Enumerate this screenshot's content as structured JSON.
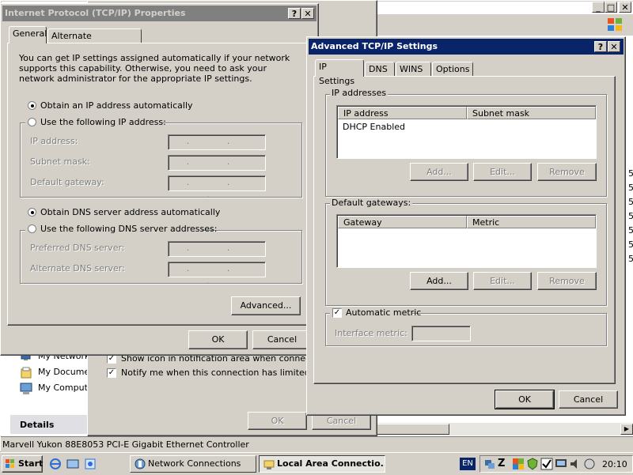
{
  "colors": {
    "desktop": "#3a6ea5",
    "title_active": "#0a246a",
    "title_inactive": "#808080",
    "face": "#d4d0c8"
  },
  "tcpip": {
    "title": "Internet Protocol (TCP/IP) Properties",
    "tabs": [
      "General",
      "Alternate Configuration"
    ],
    "intro": "You can get IP settings assigned automatically if your network supports this capability. Otherwise, you need to ask your network administrator for the appropriate IP settings.",
    "obtain_ip": "Obtain an IP address automatically",
    "use_ip": "Use the following IP address:",
    "ip_label": "IP address:",
    "subnet_label": "Subnet mask:",
    "gateway_label": "Default gateway:",
    "obtain_dns": "Obtain DNS server address automatically",
    "use_dns": "Use the following DNS server addresses:",
    "pref_dns": "Preferred DNS server:",
    "alt_dns": "Alternate DNS server:",
    "ip_placeholder": ". . .",
    "advanced": "Advanced...",
    "ok": "OK",
    "cancel": "Cancel"
  },
  "advanced": {
    "title": "Advanced TCP/IP Settings",
    "tabs": [
      "IP Settings",
      "DNS",
      "WINS",
      "Options"
    ],
    "ip_group": "IP addresses",
    "ip_headers": [
      "IP address",
      "Subnet mask"
    ],
    "ip_rows": [
      "DHCP Enabled"
    ],
    "gw_group": "Default gateways:",
    "gw_headers": [
      "Gateway",
      "Metric"
    ],
    "add": "Add...",
    "edit": "Edit...",
    "remove": "Remove",
    "auto_metric": "Automatic metric",
    "iface_metric": "Interface metric:",
    "ok": "OK",
    "cancel": "Cancel"
  },
  "background": {
    "sidebar_items": [
      "My Network",
      "My Documents",
      "My Computer"
    ],
    "details": "Details",
    "show_icon": "Show icon in notification area when connected",
    "notify": "Notify me when this connection has limited or no c",
    "ok": "OK",
    "cancel": "Cancel",
    "statusbar": "Marvell Yukon 88E8053 PCI-E Gigabit Ethernet Controller",
    "right_digits": [
      "5",
      "5",
      "5",
      "5",
      "5",
      "5",
      "5"
    ],
    "title_buttons": [
      "_",
      "□",
      "✕"
    ]
  },
  "taskbar": {
    "start": "Start",
    "items": [
      "Network Connections",
      "Local Area Connectio..."
    ],
    "lang": "EN",
    "clock": "20:10"
  }
}
